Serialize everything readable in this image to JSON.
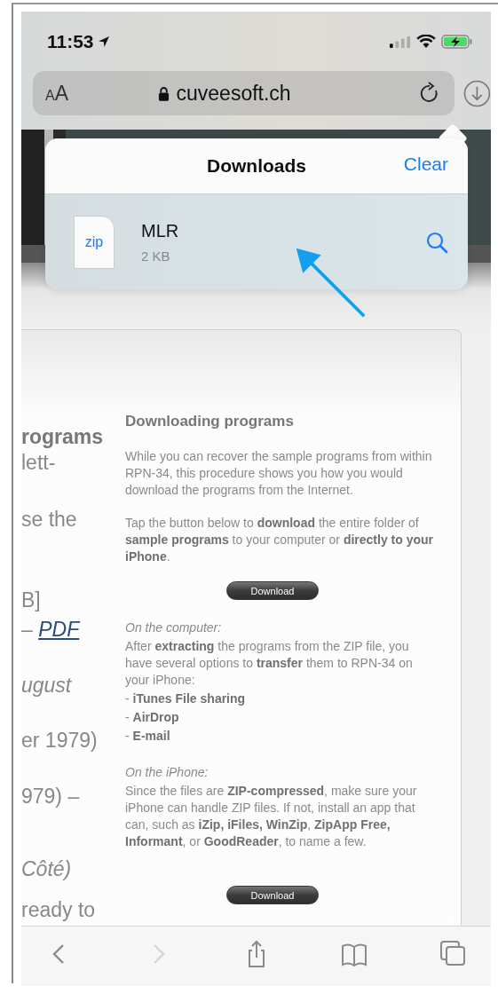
{
  "status_bar": {
    "time": "11:53"
  },
  "address_bar": {
    "text_size_button": "AA",
    "url": "cuveesoft.ch"
  },
  "downloads_popover": {
    "title": "Downloads",
    "clear_button": "Clear",
    "items": [
      {
        "name": "MLR",
        "size": "2 KB",
        "file_type": "zip"
      }
    ]
  },
  "page": {
    "left_column": [
      {
        "kind": "bold",
        "text": "rograms"
      },
      {
        "kind": "plain",
        "text": "lett-"
      },
      {
        "kind": "plain",
        "text": "se the"
      },
      {
        "kind": "plain",
        "text": "B]"
      },
      {
        "kind": "link",
        "text": "–",
        "link": "PDF"
      },
      {
        "kind": "italic",
        "text": "ugust"
      },
      {
        "kind": "plain",
        "text": "er 1979)"
      },
      {
        "kind": "plain",
        "text": "979) –"
      },
      {
        "kind": "italic",
        "text": "Côté)"
      },
      {
        "kind": "plain",
        "text": "ready to"
      }
    ],
    "section": {
      "title": "Downloading programs",
      "blocks": [
        {
          "kind": "paragraph",
          "text": "While you can recover the sample programs from within RPN-34, this procedure shows you how you would download the programs from the Internet."
        },
        {
          "kind": "paragraph",
          "text": "Tap the button below to **download** the entire folder of **sample programs** to your computer or **directly to your iPhone**."
        },
        {
          "kind": "button",
          "text": "Download"
        },
        {
          "kind": "caption",
          "text": "On the computer:"
        },
        {
          "kind": "text",
          "text": "After **extracting** the programs from the ZIP file, you have several options to **transfer** them to RPN-34 on your iPhone:"
        },
        {
          "kind": "list_item",
          "text": "- **iTunes File sharing**"
        },
        {
          "kind": "list_item",
          "text": "- **AirDrop**"
        },
        {
          "kind": "list_item",
          "text": "- **E-mail**"
        },
        {
          "kind": "caption",
          "text": "On the iPhone:"
        },
        {
          "kind": "text",
          "text": "Since the files are **ZIP-compressed**, make sure your iPhone can handle ZIP files. If not, install an app that can, such as **iZip, iFiles, WinZip**, **ZipApp Free, Informant**, or **GoodReader**, to name a few."
        },
        {
          "kind": "button",
          "text": "Download"
        }
      ]
    }
  },
  "toolbar": {
    "buttons": [
      {
        "kind": "back",
        "disabled": false
      },
      {
        "kind": "forward",
        "disabled": true
      },
      {
        "kind": "share",
        "disabled": false
      },
      {
        "kind": "bookmarks",
        "disabled": false
      },
      {
        "kind": "tabs",
        "disabled": false
      }
    ]
  }
}
